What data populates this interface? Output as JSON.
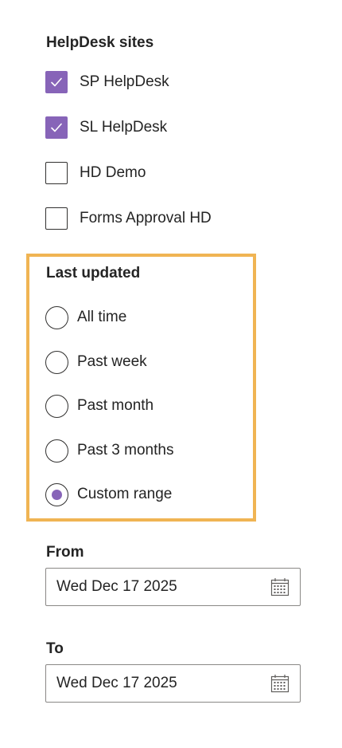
{
  "helpdesk_sites": {
    "title": "HelpDesk sites",
    "items": [
      {
        "label": "SP HelpDesk",
        "checked": true
      },
      {
        "label": "SL HelpDesk",
        "checked": true
      },
      {
        "label": "HD Demo",
        "checked": false
      },
      {
        "label": "Forms Approval HD",
        "checked": false
      }
    ]
  },
  "last_updated": {
    "title": "Last updated",
    "options": [
      {
        "label": "All time",
        "selected": false
      },
      {
        "label": "Past week",
        "selected": false
      },
      {
        "label": "Past month",
        "selected": false
      },
      {
        "label": "Past 3 months",
        "selected": false
      },
      {
        "label": "Custom range",
        "selected": true
      }
    ]
  },
  "from": {
    "label": "From",
    "value": "Wed Dec 17 2025",
    "icon": "calendar-icon"
  },
  "to": {
    "label": "To",
    "value": "Wed Dec 17 2025",
    "icon": "calendar-icon"
  },
  "colors": {
    "accent": "#8764b8",
    "highlight": "#f0b453",
    "text": "#242424",
    "border": "#8a8886"
  }
}
